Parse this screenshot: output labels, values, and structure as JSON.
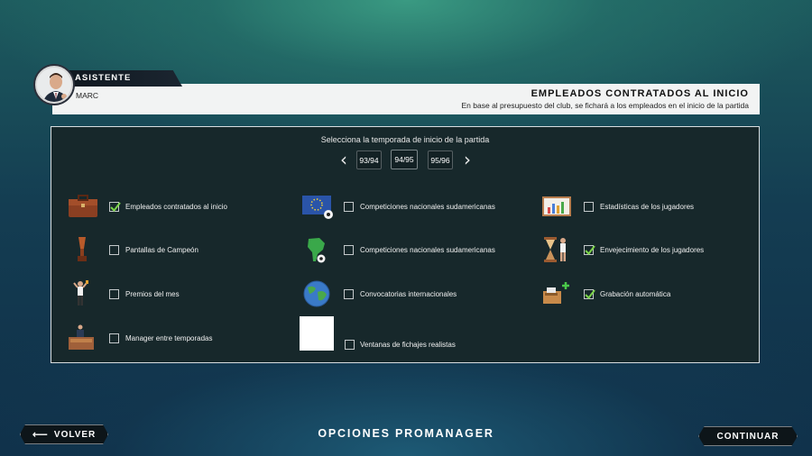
{
  "assistant": {
    "tab_label": "ASISTENTE",
    "name": "MARC",
    "title": "EMPLEADOS CONTRATADOS AL INICIO",
    "subtitle": "En base al presupuesto del club, se fichará a los empleados en el inicio de la partida"
  },
  "season": {
    "prompt": "Selecciona la temporada de inicio de la partida",
    "prev_arrow": "‹",
    "next_arrow": "›",
    "options": [
      "93/94",
      "94/95",
      "95/96"
    ],
    "selected": "94/95"
  },
  "options": [
    {
      "label": "Empleados contratados al inicio",
      "checked": true,
      "icon": "briefcase-icon"
    },
    {
      "label": "Competiciones nacionales sudamericanas",
      "checked": false,
      "icon": "eu-flag-ball-icon"
    },
    {
      "label": "Estadísticas de los jugadores",
      "checked": false,
      "icon": "stats-board-icon"
    },
    {
      "label": "Pantallas de Campeón",
      "checked": false,
      "icon": "trophy-icon"
    },
    {
      "label": "Competiciones nacionales sudamericanas",
      "checked": false,
      "icon": "south-america-map-icon"
    },
    {
      "label": "Envejecimiento de los jugadores",
      "checked": true,
      "icon": "hourglass-player-icon"
    },
    {
      "label": "Premios del mes",
      "checked": false,
      "icon": "award-player-icon"
    },
    {
      "label": "Convocatorias internacionales",
      "checked": false,
      "icon": "globe-icon"
    },
    {
      "label": "Grabación automática",
      "checked": true,
      "icon": "auto-save-icon"
    },
    {
      "label": "Manager entre temporadas",
      "checked": false,
      "icon": "manager-desk-icon"
    },
    {
      "label": "Ventanas de fichajes realistas",
      "checked": false,
      "icon": "blank-placeholder-icon"
    }
  ],
  "footer": {
    "back_arrow": "⟵",
    "back_label": "VOLVER",
    "title": "OPCIONES PROMANAGER",
    "continue_label": "CONTINUAR"
  },
  "colors": {
    "panel": "#17282b",
    "checkmark": "#7cd44a",
    "assistant_bar": "#f2f3f3"
  }
}
